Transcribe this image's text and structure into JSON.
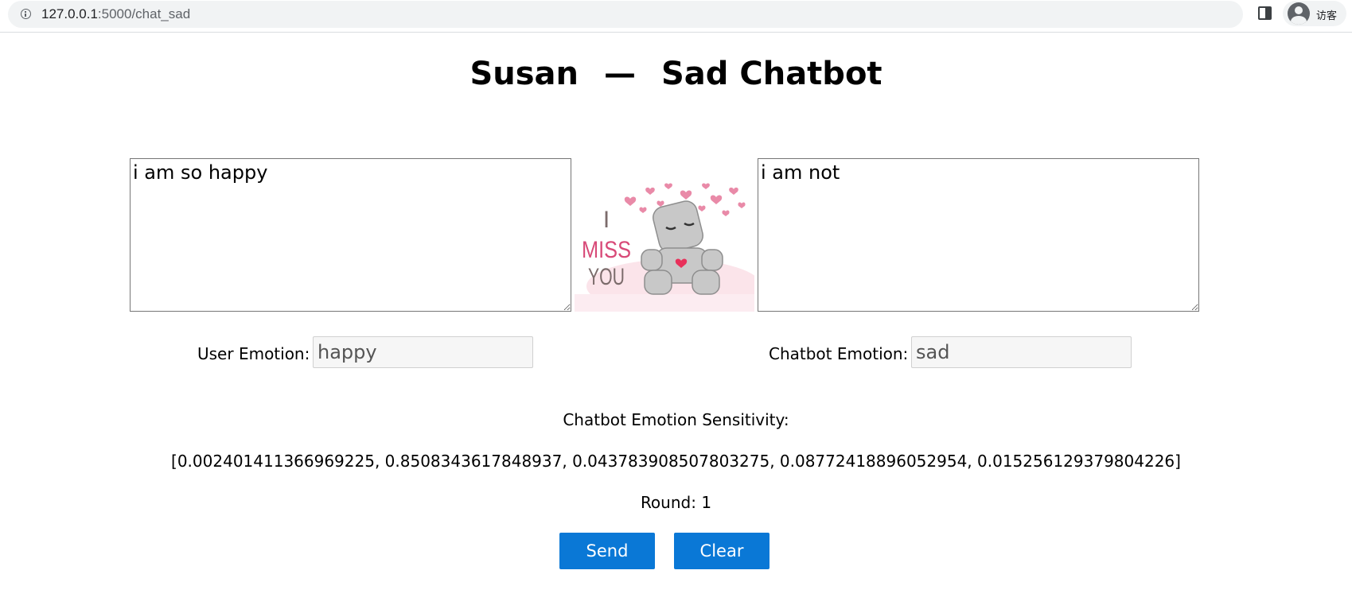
{
  "browser": {
    "url_host": "127.0.0.1",
    "url_path": ":5000/chat_sad",
    "profile_label": "访客"
  },
  "page": {
    "title_left": "Susan",
    "title_dash": "—",
    "title_right": "Sad Chatbot"
  },
  "chat": {
    "user_text": "i am so happy",
    "bot_text": "i am not",
    "image_text_line1": "I",
    "image_text_line2": "MISS",
    "image_text_line3": "YOU"
  },
  "emotions": {
    "user_label": "User Emotion:",
    "user_value": "happy",
    "bot_label": "Chatbot Emotion:",
    "bot_value": "sad"
  },
  "sensitivity": {
    "label": "Chatbot Emotion Sensitivity:",
    "values_text": "[0.002401411366969225, 0.8508343617848937, 0.043783908507803275, 0.08772418896052954, 0.015256129379804226]"
  },
  "round": {
    "text": "Round: 1"
  },
  "buttons": {
    "send_label": "Send",
    "clear_label": "Clear"
  },
  "colors": {
    "button_bg": "#0a78d6",
    "heart_pink": "#e98aa8",
    "heart_red": "#e8305a"
  }
}
